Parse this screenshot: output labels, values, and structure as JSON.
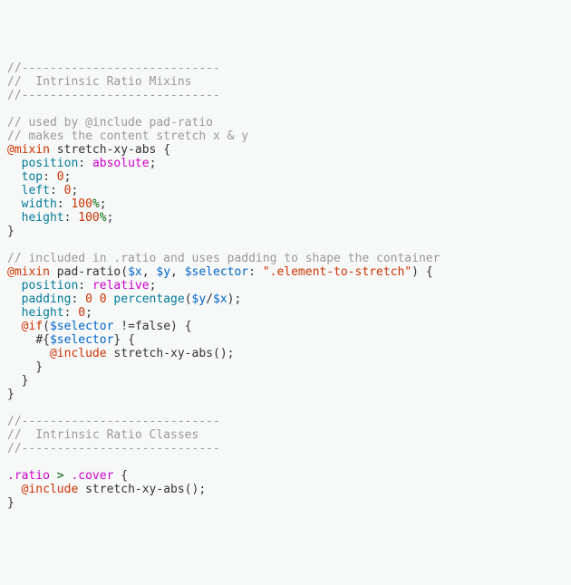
{
  "code": {
    "l1": "//----------------------------",
    "l2": "//  Intrinsic Ratio Mixins",
    "l3": "//----------------------------",
    "l5": "// used by @include pad-ratio",
    "l6": "// makes the content stretch x & y",
    "l7_at": "@mixin",
    "l7_name": " stretch-xy-abs {",
    "l8_prop": "position",
    "l8_val": "absolute",
    "l9_prop": "top",
    "l9_val": "0",
    "l10_prop": "left",
    "l10_val": "0",
    "l11_prop": "width",
    "l11_num": "100",
    "l11_unit": "%",
    "l12_prop": "height",
    "l12_num": "100",
    "l12_unit": "%",
    "l13": "}",
    "l15": "// included in .ratio and uses padding to shape the container",
    "l16_at": "@mixin",
    "l16_name": " pad-ratio(",
    "l16_x": "$x",
    "l16_y": "$y",
    "l16_sel": "$selector",
    "l16_str": "\".element-to-stretch\"",
    "l16_close": ") {",
    "l17_prop": "position",
    "l17_val": "relative",
    "l18_prop": "padding",
    "l18_z1": "0",
    "l18_z2": "0",
    "l18_func": "percentage",
    "l18_y": "$y",
    "l18_x": "$x",
    "l19_prop": "height",
    "l19_val": "0",
    "l20_at": "@if",
    "l20_sel": "$selector",
    "l20_rest": " !=false) {",
    "l21a": "#{",
    "l21_sel": "$selector",
    "l21b": "} {",
    "l22_at": "@include",
    "l22_name": " stretch-xy-abs();",
    "l23": "    }",
    "l24": "  }",
    "l25": "}",
    "l27": "//----------------------------",
    "l28": "//  Intrinsic Ratio Classes",
    "l29": "//----------------------------",
    "l31_a": ".ratio",
    "l31_gt": " > ",
    "l31_b": ".cover",
    "l31_c": " {",
    "l32_at": "@include",
    "l32_name": " stretch-xy-abs();",
    "l33": "}"
  }
}
